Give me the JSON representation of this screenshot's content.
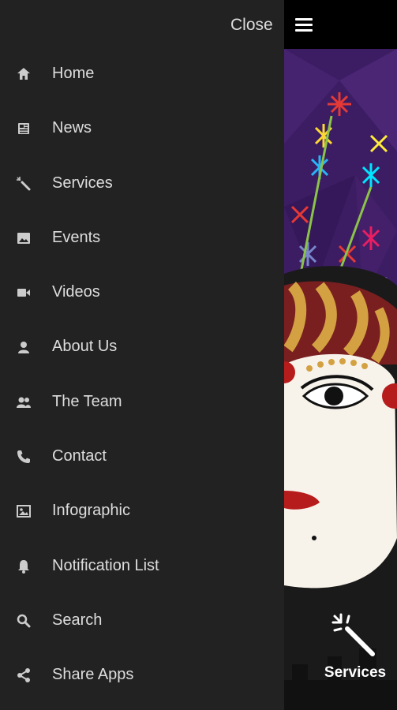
{
  "header": {
    "close_label": "Close",
    "menu_icon": "hamburger-icon"
  },
  "menu": {
    "items": [
      {
        "label": "Home",
        "icon": "home-icon"
      },
      {
        "label": "News",
        "icon": "news-icon"
      },
      {
        "label": "Services",
        "icon": "magic-wand-icon"
      },
      {
        "label": "Events",
        "icon": "image-icon"
      },
      {
        "label": "Videos",
        "icon": "video-camera-icon"
      },
      {
        "label": "About Us",
        "icon": "user-icon"
      },
      {
        "label": "The Team",
        "icon": "users-icon"
      },
      {
        "label": "Contact",
        "icon": "phone-icon"
      },
      {
        "label": "Infographic",
        "icon": "picture-icon"
      },
      {
        "label": "Notification List",
        "icon": "bell-icon"
      },
      {
        "label": "Search",
        "icon": "search-icon"
      },
      {
        "label": "Share Apps",
        "icon": "share-icon"
      }
    ]
  },
  "background": {
    "tile_label": "Services",
    "tile_icon": "magic-wand-icon"
  },
  "colors": {
    "drawer_bg": "#222222",
    "topbar_bg": "#000000",
    "art_bg": "#3c1d63"
  }
}
